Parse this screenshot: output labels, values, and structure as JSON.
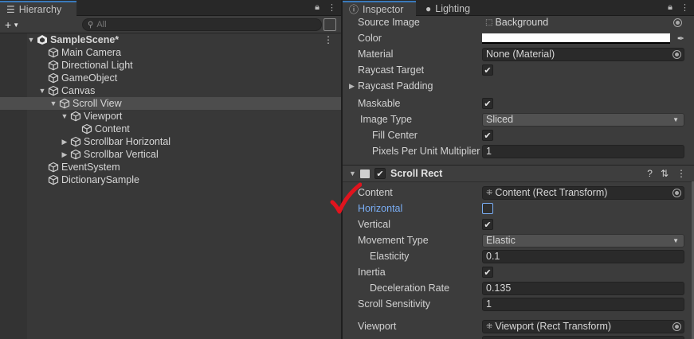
{
  "hierarchy": {
    "tab_label": "Hierarchy",
    "search_placeholder": "All",
    "items": [
      {
        "label": "SampleScene*",
        "depth": 0,
        "arrow": "▼",
        "icon": "unity-scene-icon"
      },
      {
        "label": "Main Camera",
        "depth": 1,
        "arrow": "",
        "icon": "gameobject-cube-icon"
      },
      {
        "label": "Directional Light",
        "depth": 1,
        "arrow": "",
        "icon": "gameobject-cube-icon"
      },
      {
        "label": "GameObject",
        "depth": 1,
        "arrow": "",
        "icon": "gameobject-cube-icon"
      },
      {
        "label": "Canvas",
        "depth": 1,
        "arrow": "▼",
        "icon": "gameobject-cube-icon"
      },
      {
        "label": "Scroll View",
        "depth": 2,
        "arrow": "▼",
        "icon": "gameobject-cube-icon",
        "selected": true
      },
      {
        "label": "Viewport",
        "depth": 3,
        "arrow": "▼",
        "icon": "gameobject-cube-icon"
      },
      {
        "label": "Content",
        "depth": 4,
        "arrow": "",
        "icon": "gameobject-cube-icon"
      },
      {
        "label": "Scrollbar Horizontal",
        "depth": 3,
        "arrow": "▶",
        "icon": "gameobject-cube-icon"
      },
      {
        "label": "Scrollbar Vertical",
        "depth": 3,
        "arrow": "▶",
        "icon": "gameobject-cube-icon"
      },
      {
        "label": "EventSystem",
        "depth": 1,
        "arrow": "",
        "icon": "gameobject-cube-icon"
      },
      {
        "label": "DictionarySample",
        "depth": 1,
        "arrow": "",
        "icon": "gameobject-cube-icon"
      }
    ]
  },
  "inspector": {
    "tab_inspector": "Inspector",
    "tab_lighting": "Lighting",
    "image_props": {
      "source_image_label": "Source Image",
      "source_image_value": "Background",
      "color_label": "Color",
      "material_label": "Material",
      "material_value": "None (Material)",
      "raycast_target_label": "Raycast Target",
      "raycast_padding_label": "Raycast Padding",
      "maskable_label": "Maskable",
      "image_type_label": "Image Type",
      "image_type_value": "Sliced",
      "fill_center_label": "Fill Center",
      "ppu_label": "Pixels Per Unit Multiplier",
      "ppu_value": "1"
    },
    "scroll_rect": {
      "title": "Scroll Rect",
      "content_label": "Content",
      "content_value": "Content (Rect Transform)",
      "horizontal_label": "Horizontal",
      "horizontal_checked": false,
      "vertical_label": "Vertical",
      "vertical_checked": true,
      "movement_type_label": "Movement Type",
      "movement_type_value": "Elastic",
      "elasticity_label": "Elasticity",
      "elasticity_value": "0.1",
      "inertia_label": "Inertia",
      "deceleration_label": "Deceleration Rate",
      "deceleration_value": "0.135",
      "scroll_sensitivity_label": "Scroll Sensitivity",
      "scroll_sensitivity_value": "1",
      "viewport_label": "Viewport",
      "viewport_value": "Viewport (Rect Transform)"
    }
  },
  "annotation_color": "#e0141e"
}
